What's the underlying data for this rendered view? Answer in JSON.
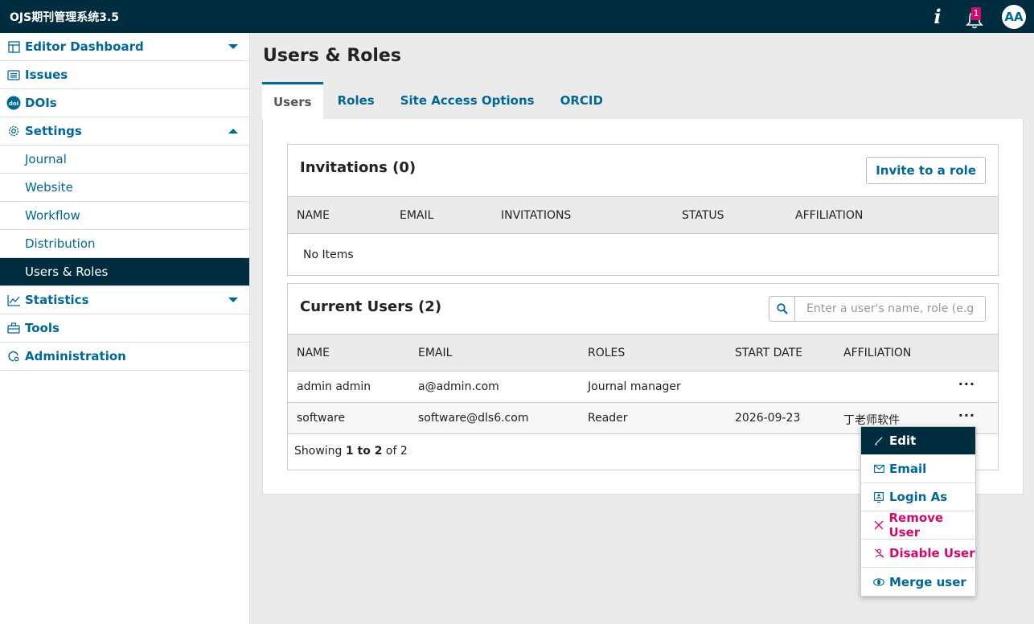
{
  "header": {
    "title": "OJS期刊管理系统3.5",
    "notification_count": "1",
    "avatar_initials": "AA"
  },
  "sidebar": {
    "items": [
      {
        "label": "Editor Dashboard"
      },
      {
        "label": "Issues"
      },
      {
        "label": "DOIs"
      },
      {
        "label": "Settings"
      },
      {
        "label": "Journal"
      },
      {
        "label": "Website"
      },
      {
        "label": "Workflow"
      },
      {
        "label": "Distribution"
      },
      {
        "label": "Users & Roles"
      },
      {
        "label": "Statistics"
      },
      {
        "label": "Tools"
      },
      {
        "label": "Administration"
      }
    ]
  },
  "main": {
    "title": "Users & Roles",
    "tabs": [
      {
        "label": "Users"
      },
      {
        "label": "Roles"
      },
      {
        "label": "Site Access Options"
      },
      {
        "label": "ORCID"
      }
    ]
  },
  "invitations": {
    "title": "Invitations (0)",
    "invite_button": "Invite to a role",
    "columns": [
      "NAME",
      "EMAIL",
      "INVITATIONS",
      "STATUS",
      "AFFILIATION"
    ],
    "empty_text": "No Items"
  },
  "users": {
    "title": "Current Users (2)",
    "search_placeholder": "Enter a user's name, role (e.g",
    "columns": [
      "NAME",
      "EMAIL",
      "ROLES",
      "START DATE",
      "AFFILIATION"
    ],
    "rows": [
      {
        "name": "admin admin",
        "email": "a@admin.com",
        "roles": "Journal manager",
        "start_date": "",
        "affiliation": ""
      },
      {
        "name": "software",
        "email": "software@dls6.com",
        "roles": "Reader",
        "start_date": "2026-09-23",
        "affiliation": "丁老师软件"
      }
    ],
    "showing_prefix": "Showing",
    "showing_range": "1 to 2",
    "showing_suffix": "of 2"
  },
  "row_menu": {
    "items": [
      {
        "label": "Edit"
      },
      {
        "label": "Email"
      },
      {
        "label": "Login As"
      },
      {
        "label": "Remove User"
      },
      {
        "label": "Disable User"
      },
      {
        "label": "Merge user"
      }
    ]
  },
  "colors": {
    "header_bg": "#002c40",
    "primary": "#006798",
    "danger": "#d00a6c",
    "badge": "#d00a6c"
  }
}
